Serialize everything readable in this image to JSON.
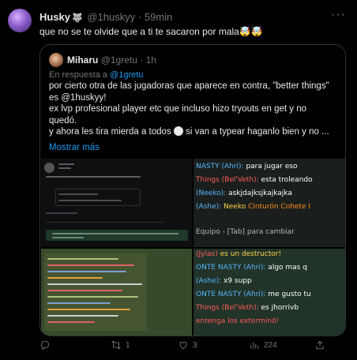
{
  "tweet": {
    "author_name": "Husky",
    "author_badge": "🐺",
    "handle": "@1huskyy",
    "time": "59min",
    "text": "que no se te olvide que a ti te sacaron por mala🤯🤯",
    "more_icon": "more-dots-icon"
  },
  "quote": {
    "author_name": "Miharu",
    "handle": "@1gretu",
    "time": "1h",
    "reply_prefix": "En respuesta a",
    "reply_to": "@1gretu",
    "lines": [
      "por cierto otra de las jugadoras que aparece en contra, \"better things\"",
      "es @1huskyy!",
      "ex lvp profesional player etc que incluso hizo tryouts en get y no",
      "quedó.",
      "y ahora les tira mierda a todos",
      "si van a typear haganlo bien y no ..."
    ],
    "show_more": "Mostrar más"
  },
  "media": {
    "img2_lines": [
      {
        "who": "NASTY (Ahri):",
        "msg": " para jugar eso"
      },
      {
        "who": "Things (Bel'Veth):",
        "msg": " esta troleando"
      },
      {
        "who": "(Neeko):",
        "msg": " askjdajksjkajkajka"
      },
      {
        "who": "(Ashe):",
        "msg": " Neeko"
      },
      {
        "who": "",
        "msg": "Cinturón Cohete I"
      },
      {
        "who": "Equipo - [Tab] para cambiar",
        "msg": ""
      }
    ],
    "img4_lines": [
      {
        "who": "(Jylas)",
        "msg": " es un destructor!"
      },
      {
        "who": "ONTE NASTY (Ahri):",
        "msg": " algo mas q"
      },
      {
        "who": "(Ashe):",
        "msg": " x9 supp"
      },
      {
        "who": "ONTE NASTY (Ahri):",
        "msg": " me gusto tu"
      },
      {
        "who": "Things (Bel'Veth):",
        "msg": " es jhorrivb"
      },
      {
        "who": "",
        "msg": "entenga los exterminó!"
      }
    ]
  },
  "actions": {
    "reply_count": "",
    "retweet_count": "1",
    "like_count": "3",
    "views_count": "224"
  }
}
